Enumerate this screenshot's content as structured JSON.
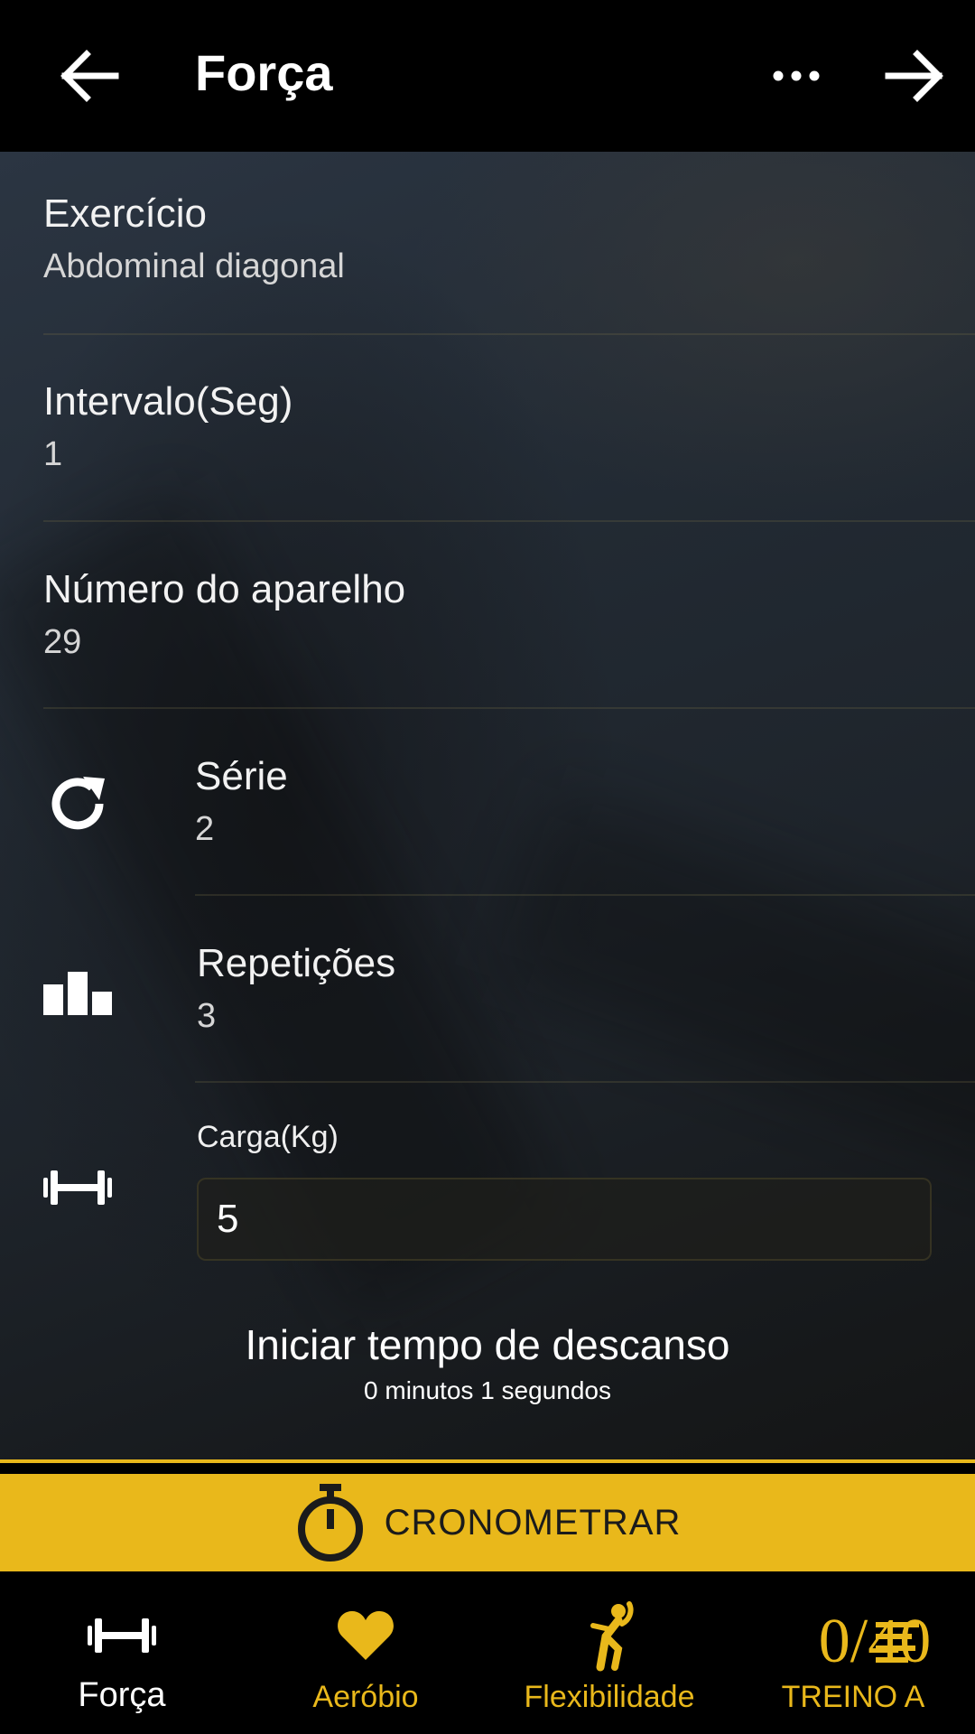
{
  "topbar": {
    "title": "Força",
    "back_icon": "arrow-left-icon",
    "more_icon": "more-horizontal-icon",
    "forward_icon": "arrow-right-icon"
  },
  "fields": {
    "exercise": {
      "label": "Exercício",
      "value": "Abdominal diagonal"
    },
    "interval": {
      "label": "Intervalo(Seg)",
      "value": "1"
    },
    "device_number": {
      "label": "Número do aparelho",
      "value": "29"
    },
    "series": {
      "label": "Série",
      "value": "2",
      "icon": "refresh-icon"
    },
    "repetitions": {
      "label": "Repetições",
      "value": "3",
      "icon": "bar-steps-icon"
    },
    "load": {
      "label": "Carga(Kg)",
      "value": "5",
      "icon": "dumbbell-icon"
    }
  },
  "rest": {
    "title": "Iniciar tempo de descanso",
    "subtitle": "0 minutos 1 segundos"
  },
  "timer_button": {
    "label": "CRONOMETRAR",
    "icon": "stopwatch-icon"
  },
  "bottom_nav": {
    "items": [
      {
        "label": "Força",
        "icon": "dumbbell-icon",
        "active": true
      },
      {
        "label": "Aeróbio",
        "icon": "heart-icon",
        "active": false
      },
      {
        "label": "Flexibilidade",
        "icon": "stretch-icon",
        "active": false
      },
      {
        "label": "TREINO A",
        "counter": "0/40",
        "icon": "list-lines-icon",
        "active": false
      }
    ]
  },
  "colors": {
    "accent": "#e9b81b",
    "background": "#000000",
    "text": "#ffffff"
  }
}
